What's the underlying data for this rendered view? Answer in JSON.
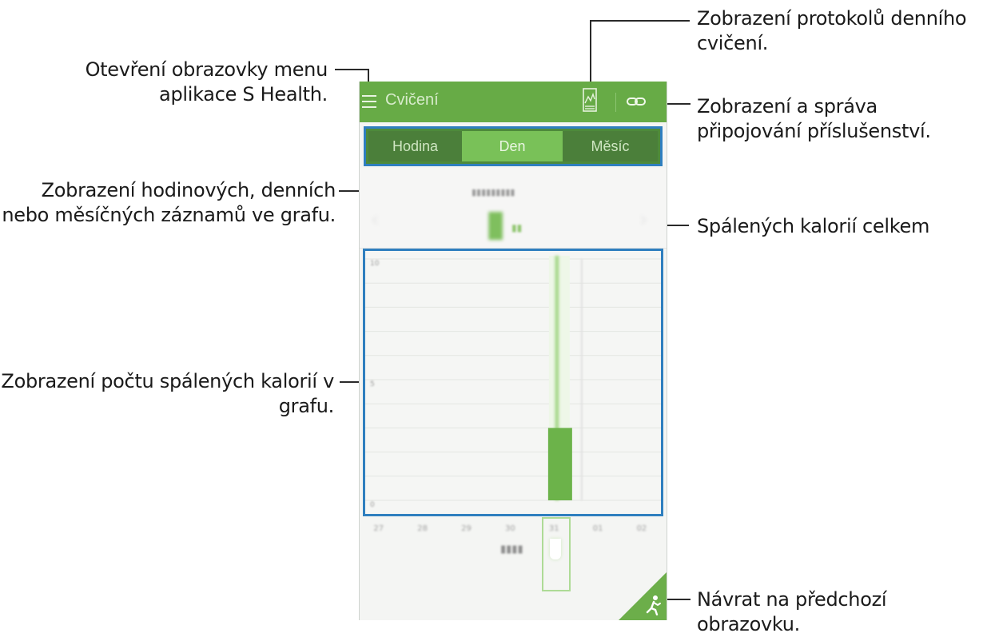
{
  "annotations": {
    "menu": "Otevření obrazovky menu aplikace S Health.",
    "log": "Zobrazení protokolů denního cvičení.",
    "accessory": "Zobrazení a správa připojování příslušenství.",
    "period": "Zobrazení hodinových, denních nebo měsíčných záznamů ve grafu.",
    "total": "Spálených kalorií celkem",
    "graph": "Zobrazení počtu spálených kalorií v grafu.",
    "back": "Návrat na předchozí obrazovku."
  },
  "app": {
    "title": "Cvičení",
    "tabs": [
      "Hodina",
      "Den",
      "Měsíc"
    ],
    "selected_tab": "Den",
    "colors": {
      "bar": "#67ab46",
      "tab_active": "#79c158",
      "tab_inactive": "#4b7f3a",
      "highlight_box": "#2f7fbf"
    },
    "icons": {
      "menu": "hamburger-icon",
      "log": "log-chart-icon",
      "accessory": "link-icon",
      "back": "running-figure-icon"
    }
  },
  "chart_data": {
    "type": "bar",
    "categories": [
      "27",
      "28",
      "29",
      "30",
      "31",
      "01",
      "02"
    ],
    "values": [
      0,
      0,
      0,
      0,
      3,
      0,
      0
    ],
    "selected_index": 4,
    "y_ticks": [
      "10",
      "5",
      "0"
    ]
  }
}
